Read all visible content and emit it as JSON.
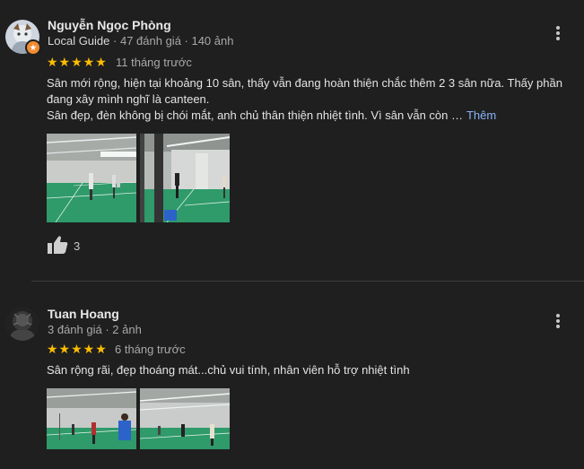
{
  "reviews": [
    {
      "name": "Nguyễn Ngọc Phòng",
      "local_guide": "Local Guide",
      "stats": "47 đánh giá · 140 ảnh",
      "stars": "★★★★★",
      "rating": 5,
      "date": "11 tháng trước",
      "text_line1": "Sân mới rộng, hiện tại khoảng 10 sân, thấy vẫn đang hoàn thiện chắc thêm 2 3 sân nữa. Thấy phần",
      "text_line2": "đang xây mình nghĩ là canteen.",
      "text_line3": "Sân đẹp, đèn không bị chói mắt, anh chủ thân thiện nhiệt tình. Vì sân vẫn còn …",
      "more_label": "Thêm",
      "likes": "3"
    },
    {
      "name": "Tuan Hoang",
      "stats": "3 đánh giá · 2 ảnh",
      "stars": "★★★★★",
      "rating": 5,
      "date": "6 tháng trước",
      "text_line1": "Sân rộng rãi, đẹp thoáng mát...chủ vui tính, nhân viên hỗ trợ nhiệt tình"
    }
  ],
  "colors": {
    "background": "#1f1f1f",
    "star": "#fbbc04",
    "link": "#8ab4f8",
    "court_floor": "#2f9a6a",
    "local_guide_badge": "#f28b30"
  },
  "icons": [
    "more-vert-icon",
    "thumbs-up-icon",
    "local-guide-badge-icon"
  ]
}
